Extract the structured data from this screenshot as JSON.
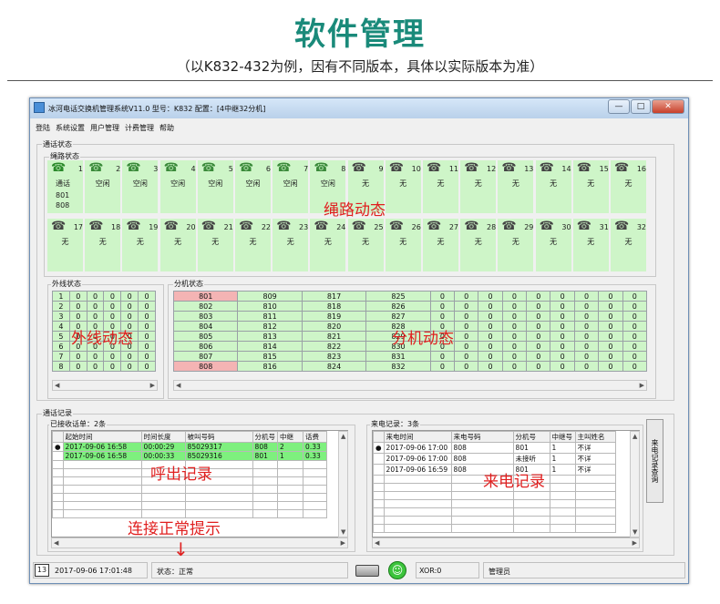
{
  "header": {
    "title": "软件管理",
    "subtitle": "（以K832-432为例，因有不同版本，具体以实际版本为准）"
  },
  "window": {
    "title": "冰河电话交换机管理系统V11.0    型号：K832  配置：[4中继32分机]",
    "min": "—",
    "max": "□",
    "close": "✕"
  },
  "menu": [
    "登陆",
    "系统设置",
    "用户管理",
    "计费管理",
    "帮助"
  ],
  "call_status": {
    "label": "通话状态",
    "ropes_label": "绳路状态"
  },
  "ropes": [
    {
      "n": "1",
      "status": "通话",
      "extra": [
        "801",
        "808"
      ]
    },
    {
      "n": "2",
      "status": "空闲"
    },
    {
      "n": "3",
      "status": "空闲"
    },
    {
      "n": "4",
      "status": "空闲"
    },
    {
      "n": "5",
      "status": "空闲"
    },
    {
      "n": "6",
      "status": "空闲"
    },
    {
      "n": "7",
      "status": "空闲"
    },
    {
      "n": "8",
      "status": "空闲"
    },
    {
      "n": "9",
      "status": "无"
    },
    {
      "n": "10",
      "status": "无"
    },
    {
      "n": "11",
      "status": "无"
    },
    {
      "n": "12",
      "status": "无"
    },
    {
      "n": "13",
      "status": "无"
    },
    {
      "n": "14",
      "status": "无"
    },
    {
      "n": "15",
      "status": "无"
    },
    {
      "n": "16",
      "status": "无"
    },
    {
      "n": "17",
      "status": "无"
    },
    {
      "n": "18",
      "status": "无"
    },
    {
      "n": "19",
      "status": "无"
    },
    {
      "n": "20",
      "status": "无"
    },
    {
      "n": "21",
      "status": "无"
    },
    {
      "n": "22",
      "status": "无"
    },
    {
      "n": "23",
      "status": "无"
    },
    {
      "n": "24",
      "status": "无"
    },
    {
      "n": "25",
      "status": "无"
    },
    {
      "n": "26",
      "status": "无"
    },
    {
      "n": "27",
      "status": "无"
    },
    {
      "n": "28",
      "status": "无"
    },
    {
      "n": "29",
      "status": "无"
    },
    {
      "n": "30",
      "status": "无"
    },
    {
      "n": "31",
      "status": "无"
    },
    {
      "n": "32",
      "status": "无"
    }
  ],
  "annotations": {
    "ropes": "绳路动态",
    "trunk": "外线动态",
    "ext": "分机动态",
    "outgoing": "呼出记录",
    "incoming": "来电记录",
    "status_hint": "连接正常提示",
    "arrow": "↓"
  },
  "trunk": {
    "label": "外线状态",
    "rows": [
      [
        "1",
        "0",
        "0",
        "0",
        "0",
        "0"
      ],
      [
        "2",
        "0",
        "0",
        "0",
        "0",
        "0"
      ],
      [
        "3",
        "0",
        "0",
        "0",
        "0",
        "0"
      ],
      [
        "4",
        "0",
        "0",
        "0",
        "0",
        "0"
      ],
      [
        "5",
        "0",
        "0",
        "0",
        "0",
        "0"
      ],
      [
        "6",
        "0",
        "0",
        "0",
        "0",
        "0"
      ],
      [
        "7",
        "0",
        "0",
        "0",
        "0",
        "0"
      ],
      [
        "8",
        "0",
        "0",
        "0",
        "0",
        "0"
      ]
    ]
  },
  "ext": {
    "label": "分机状态",
    "rows": [
      [
        "801",
        "809",
        "817",
        "825",
        "0",
        "0",
        "0",
        "0",
        "0",
        "0",
        "0",
        "0",
        "0"
      ],
      [
        "802",
        "810",
        "818",
        "826",
        "0",
        "0",
        "0",
        "0",
        "0",
        "0",
        "0",
        "0",
        "0"
      ],
      [
        "803",
        "811",
        "819",
        "827",
        "0",
        "0",
        "0",
        "0",
        "0",
        "0",
        "0",
        "0",
        "0"
      ],
      [
        "804",
        "812",
        "820",
        "828",
        "0",
        "0",
        "0",
        "0",
        "0",
        "0",
        "0",
        "0",
        "0"
      ],
      [
        "805",
        "813",
        "821",
        "829",
        "0",
        "0",
        "0",
        "0",
        "0",
        "0",
        "0",
        "0",
        "0"
      ],
      [
        "806",
        "814",
        "822",
        "830",
        "0",
        "0",
        "0",
        "0",
        "0",
        "0",
        "0",
        "0",
        "0"
      ],
      [
        "807",
        "815",
        "823",
        "831",
        "0",
        "0",
        "0",
        "0",
        "0",
        "0",
        "0",
        "0",
        "0"
      ],
      [
        "808",
        "816",
        "824",
        "832",
        "0",
        "0",
        "0",
        "0",
        "0",
        "0",
        "0",
        "0",
        "0"
      ]
    ]
  },
  "records": {
    "label": "通话记录",
    "out_label": "已接收话单：2条",
    "in_label": "来电记录：3条",
    "side_button": "来电记录查询"
  },
  "out_headers": [
    "",
    "起始时间",
    "时间长度",
    "被叫号码",
    "分机号",
    "中继",
    "话费"
  ],
  "out_rows": [
    [
      "●",
      "2017-09-06 16:58",
      "00:00:29",
      "85029317",
      "808",
      "2",
      "0.33"
    ],
    [
      "",
      "2017-09-06 16:58",
      "00:00:33",
      "85029316",
      "801",
      "1",
      "0.33"
    ]
  ],
  "in_headers": [
    "",
    "来电时间",
    "来电号码",
    "分机号",
    "中继号",
    "主叫姓名"
  ],
  "in_rows": [
    [
      "●",
      "2017-09-06 17:00",
      "808",
      "801",
      "1",
      "不详"
    ],
    [
      "",
      "2017-09-06 17:00",
      "808",
      "未接听",
      "1",
      "不详"
    ],
    [
      "",
      "2017-09-06 16:59",
      "808",
      "801",
      "1",
      "不详"
    ]
  ],
  "statusbar": {
    "time": "2017-09-06 17:01:48",
    "state": "状态：正常",
    "xor": "XOR:0",
    "user": "管理员",
    "clock_icon": "13"
  },
  "colors": {
    "green_cell": "#cef5c8",
    "red_cell": "#f4b4b4",
    "row_green": "#7ef07e",
    "annotation": "#e02020"
  }
}
